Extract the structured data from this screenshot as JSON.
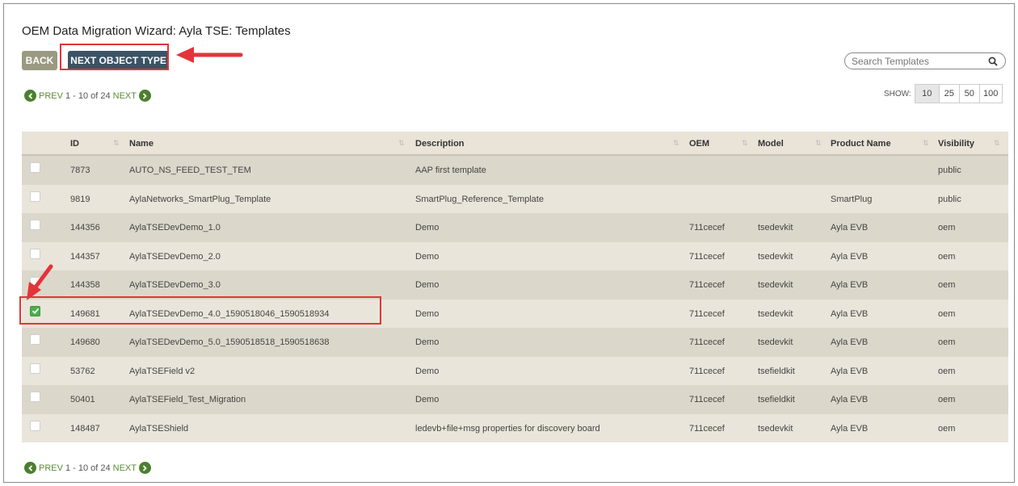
{
  "page": {
    "title": "OEM Data Migration Wizard: Ayla TSE: Templates"
  },
  "toolbar": {
    "back_label": "BACK",
    "next_label": "NEXT OBJECT TYPE"
  },
  "search": {
    "placeholder": "Search Templates"
  },
  "pagination": {
    "prev_label": "PREV",
    "range_text": "1 - 10 of 24",
    "next_label": "NEXT"
  },
  "show": {
    "label": "SHOW:",
    "options": [
      "10",
      "25",
      "50",
      "100"
    ],
    "selected": "10"
  },
  "table": {
    "columns": [
      "ID",
      "Name",
      "Description",
      "OEM",
      "Model",
      "Product Name",
      "Visibility"
    ],
    "rows": [
      {
        "checked": false,
        "id": "7873",
        "name": "AUTO_NS_FEED_TEST_TEM",
        "description": "AAP first template",
        "oem": "",
        "model": "",
        "product": "",
        "visibility": "public"
      },
      {
        "checked": false,
        "id": "9819",
        "name": "AylaNetworks_SmartPlug_Template",
        "description": "SmartPlug_Reference_Template",
        "oem": "",
        "model": "",
        "product": "SmartPlug",
        "visibility": "public"
      },
      {
        "checked": false,
        "id": "144356",
        "name": "AylaTSEDevDemo_1.0",
        "description": "Demo",
        "oem": "711cecef",
        "model": "tsedevkit",
        "product": "Ayla EVB",
        "visibility": "oem"
      },
      {
        "checked": false,
        "id": "144357",
        "name": "AylaTSEDevDemo_2.0",
        "description": "Demo",
        "oem": "711cecef",
        "model": "tsedevkit",
        "product": "Ayla EVB",
        "visibility": "oem"
      },
      {
        "checked": false,
        "id": "144358",
        "name": "AylaTSEDevDemo_3.0",
        "description": "Demo",
        "oem": "711cecef",
        "model": "tsedevkit",
        "product": "Ayla EVB",
        "visibility": "oem"
      },
      {
        "checked": true,
        "id": "149681",
        "name": "AylaTSEDevDemo_4.0_1590518046_1590518934",
        "description": "Demo",
        "oem": "711cecef",
        "model": "tsedevkit",
        "product": "Ayla EVB",
        "visibility": "oem"
      },
      {
        "checked": false,
        "id": "149680",
        "name": "AylaTSEDevDemo_5.0_1590518518_1590518638",
        "description": "Demo",
        "oem": "711cecef",
        "model": "tsedevkit",
        "product": "Ayla EVB",
        "visibility": "oem"
      },
      {
        "checked": false,
        "id": "53762",
        "name": "AylaTSEField v2",
        "description": "Demo",
        "oem": "711cecef",
        "model": "tsefieldkit",
        "product": "Ayla EVB",
        "visibility": "oem"
      },
      {
        "checked": false,
        "id": "50401",
        "name": "AylaTSEField_Test_Migration",
        "description": "Demo",
        "oem": "711cecef",
        "model": "tsefieldkit",
        "product": "Ayla EVB",
        "visibility": "oem"
      },
      {
        "checked": false,
        "id": "148487",
        "name": "AylaTSEShield",
        "description": "ledevb+file+msg properties for discovery board",
        "oem": "711cecef",
        "model": "tsedevkit",
        "product": "Ayla EVB",
        "visibility": "oem"
      }
    ]
  },
  "colors": {
    "accent_green": "#4c7f2e",
    "next_button": "#3a5366",
    "back_button": "#9a9a82",
    "annotation_red": "#e3343a"
  }
}
